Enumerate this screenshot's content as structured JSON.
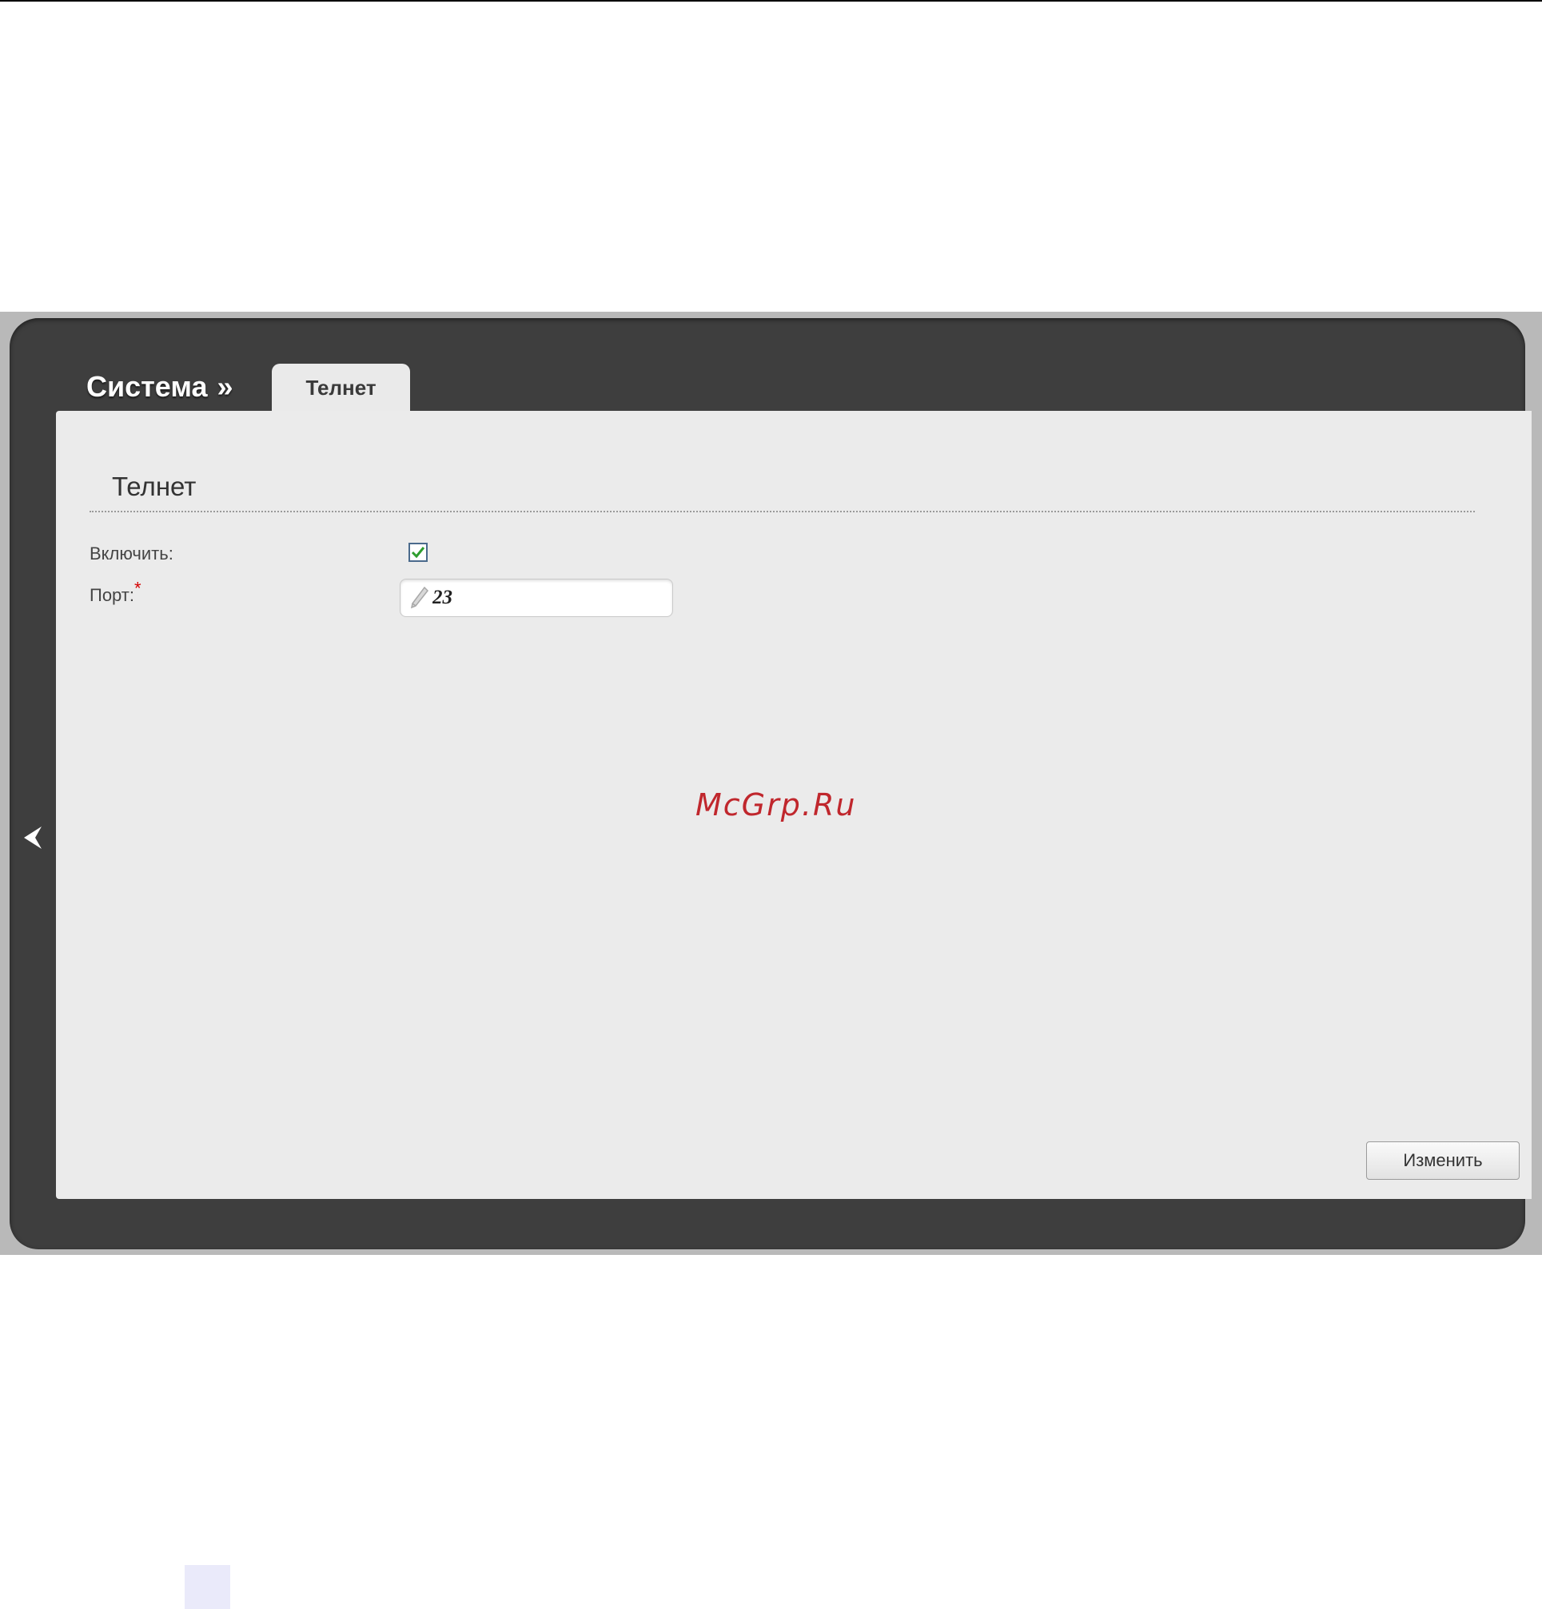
{
  "header": {
    "breadcrumb_section": "Система",
    "breadcrumb_separator": "»",
    "active_tab": "Телнет"
  },
  "form": {
    "section_title": "Телнет",
    "enable_label": "Включить:",
    "enable_checked": true,
    "port_label": "Порт:",
    "port_required_mark": "*",
    "port_value": "23"
  },
  "actions": {
    "apply_label": "Изменить"
  },
  "watermark": "McGrp.Ru",
  "colors": {
    "frame": "#3e3e3e",
    "content_bg": "#ebebeb",
    "checkmark": "#2e9d2e",
    "required": "#d40000",
    "watermark": "#c0272d"
  }
}
